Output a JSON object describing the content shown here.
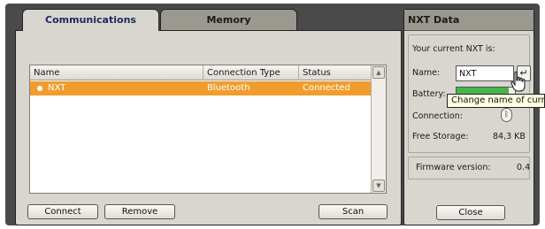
{
  "tabs": [
    {
      "label": "Communications",
      "active": true
    },
    {
      "label": "Memory",
      "active": false
    }
  ],
  "device_list": {
    "columns": [
      "Name",
      "Connection Type",
      "Status"
    ],
    "rows": [
      {
        "name": "NXT",
        "connection_type": "Bluetooth",
        "status": "Connected",
        "selected": true
      }
    ]
  },
  "buttons": {
    "connect": "Connect",
    "remove": "Remove",
    "scan": "Scan",
    "close": "Close"
  },
  "nxt_data": {
    "title": "NXT Data",
    "current_label": "Your current NXT is:",
    "name_label": "Name:",
    "name_value": "NXT",
    "battery_label": "Battery:",
    "battery_level_percent": 90,
    "connection_label": "Connection:",
    "connection_icon": "bluetooth-icon",
    "free_storage_label": "Free Storage:",
    "free_storage_value": "84,3 KB",
    "firmware_label": "Firmware version:",
    "firmware_value": "0.4"
  },
  "tooltip": "Change name of current NXT",
  "colors": {
    "selection": "#f19d2e",
    "panel": "#d9d6cf",
    "tab_inactive": "#9a988f",
    "battery": "#45b54a"
  }
}
